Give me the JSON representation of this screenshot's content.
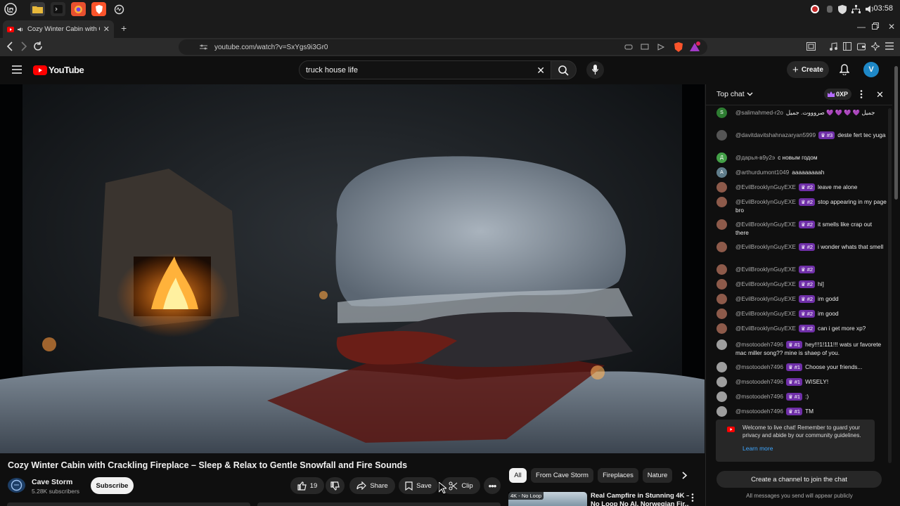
{
  "browser": {
    "clock": "03:58",
    "tab_title": "Cozy Winter Cabin with Cr",
    "url": "youtube.com/watch?v=SxYgs9i3Gr0"
  },
  "youtube": {
    "logo_text": "YouTube",
    "search_value": "truck house life",
    "create_label": "Create",
    "avatar_letter": "V"
  },
  "video": {
    "title": "Cozy Winter Cabin with Crackling Fireplace – Sleep & Relax to Gentle Snowfall and Fire Sounds",
    "channel": "Cave Storm",
    "subscribers": "5.28K subscribers",
    "subscribe_label": "Subscribe",
    "likes": "19",
    "share_label": "Share",
    "save_label": "Save",
    "clip_label": "Clip"
  },
  "chips": [
    "All",
    "From Cave Storm",
    "Fireplaces",
    "Nature"
  ],
  "recommended": {
    "badge": "4K - No Loop",
    "title_line1": "Real Campfire in Stunning 4K –",
    "title_line2": "No Loop No AI, Norwegian Fir..."
  },
  "chat": {
    "mode": "Top chat",
    "points": "0XP",
    "messages": [
      {
        "author": "@salimahmed-r2o",
        "text": "جميل 💜 💜 💜 💜 صروووت. جميل",
        "badge": "",
        "avatar": "S",
        "color": "#2e7d32"
      },
      {
        "author": "@davitdavitshahnazaryan5999",
        "badge": "#3",
        "text": "deste fert tec yuga",
        "avatar": "",
        "color": "#555"
      },
      {
        "author": "@дарья-в9у2э",
        "badge": "",
        "text": "с новым годом",
        "avatar": "Д",
        "color": "#43a047"
      },
      {
        "author": "@arthurdumont1049",
        "badge": "",
        "text": "aaaaaaaaah",
        "avatar": "A",
        "color": "#607d8b"
      },
      {
        "author": "@EvilBrooklynGuyEXE",
        "badge": "#2",
        "text": "leave me alone",
        "avatar": "",
        "color": "#8d5a4a"
      },
      {
        "author": "@EvilBrooklynGuyEXE",
        "badge": "#2",
        "text": "stop appearing in my page bro",
        "avatar": "",
        "color": "#8d5a4a"
      },
      {
        "author": "@EvilBrooklynGuyEXE",
        "badge": "#2",
        "text": "it smells like crap out there",
        "avatar": "",
        "color": "#8d5a4a"
      },
      {
        "author": "@EvilBrooklynGuyEXE",
        "badge": "#2",
        "text": "i wonder whats that smell",
        "avatar": "",
        "color": "#8d5a4a"
      },
      {
        "author": "@EvilBrooklynGuyEXE",
        "badge": "#2",
        "text": "",
        "avatar": "",
        "color": "#8d5a4a"
      },
      {
        "author": "@EvilBrooklynGuyEXE",
        "badge": "#2",
        "text": "hi]",
        "avatar": "",
        "color": "#8d5a4a"
      },
      {
        "author": "@EvilBrooklynGuyEXE",
        "badge": "#2",
        "text": "im godd",
        "avatar": "",
        "color": "#8d5a4a"
      },
      {
        "author": "@EvilBrooklynGuyEXE",
        "badge": "#2",
        "text": "im good",
        "avatar": "",
        "color": "#8d5a4a"
      },
      {
        "author": "@EvilBrooklynGuyEXE",
        "badge": "#2",
        "text": "can i get more xp?",
        "avatar": "",
        "color": "#8d5a4a"
      },
      {
        "author": "@msotoodeh7496",
        "badge": "#1",
        "text": "hey!!!1!111!!! wats ur favorete mac miller song?? mine is shaep of you.",
        "avatar": "",
        "color": "#9e9e9e"
      },
      {
        "author": "@msotoodeh7496",
        "badge": "#1",
        "text": "Choose your friends...",
        "avatar": "",
        "color": "#9e9e9e"
      },
      {
        "author": "@msotoodeh7496",
        "badge": "#1",
        "text": "WISELY!",
        "avatar": "",
        "color": "#9e9e9e"
      },
      {
        "author": "@msotoodeh7496",
        "badge": "#1",
        "text": ":)",
        "avatar": "",
        "color": "#9e9e9e"
      },
      {
        "author": "@msotoodeh7496",
        "badge": "#1",
        "text": "TM",
        "avatar": "",
        "color": "#9e9e9e"
      }
    ],
    "welcome_text": "Welcome to live chat! Remember to guard your privacy and abide by our community guidelines.",
    "learn_more": "Learn more",
    "join_label": "Create a channel to join the chat",
    "public_note": "All messages you send will appear publicly"
  }
}
